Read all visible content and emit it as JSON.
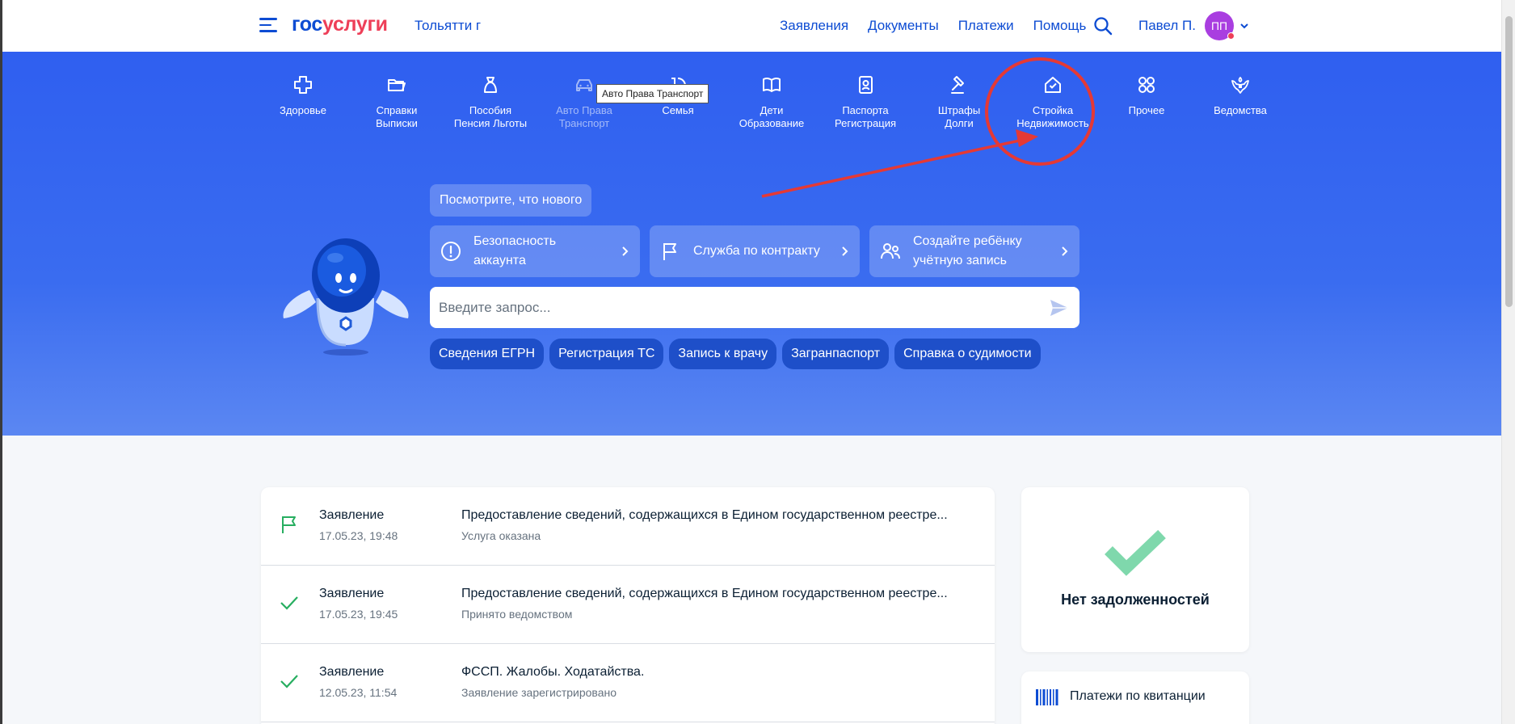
{
  "header": {
    "logo_part1": "гос",
    "logo_part2": "услуги",
    "city": "Тольятти г",
    "nav": [
      "Заявления",
      "Документы",
      "Платежи",
      "Помощь"
    ],
    "user_name": "Павел П.",
    "avatar_initials": "ПП",
    "brand_color": "#0d4cd3",
    "accent_color": "#ee3f58"
  },
  "categories": [
    {
      "line1": "Здоровье",
      "line2": "",
      "icon": "medical-cross-icon"
    },
    {
      "line1": "Справки",
      "line2": "Выписки",
      "icon": "folder-icon"
    },
    {
      "line1": "Пособия",
      "line2": "Пенсия Льготы",
      "icon": "money-bag-icon"
    },
    {
      "line1": "Авто Права",
      "line2": "Транспорт",
      "icon": "car-icon"
    },
    {
      "line1": "Семья",
      "line2": "",
      "icon": "stroller-icon"
    },
    {
      "line1": "Дети",
      "line2": "Образование",
      "icon": "book-icon"
    },
    {
      "line1": "Паспорта",
      "line2": "Регистрация",
      "icon": "passport-icon"
    },
    {
      "line1": "Штрафы",
      "line2": "Долги",
      "icon": "gavel-icon"
    },
    {
      "line1": "Стройка",
      "line2": "Недвижимость",
      "icon": "house-icon"
    },
    {
      "line1": "Прочее",
      "line2": "",
      "icon": "grid-icon"
    },
    {
      "line1": "Ведомства",
      "line2": "",
      "icon": "coat-of-arms-icon"
    }
  ],
  "tooltip": "Авто Права Транспорт",
  "hero": {
    "news_chip": "Посмотрите, что нового",
    "cards": [
      {
        "line1": "Безопасность",
        "line2": "аккаунта",
        "icon": "alert-circle-icon"
      },
      {
        "line1": "Служба по контракту",
        "line2": "",
        "icon": "flag-icon"
      },
      {
        "line1": "Создайте ребёнку",
        "line2": "учётную запись",
        "icon": "users-icon"
      }
    ],
    "search_placeholder": "Введите запрос...",
    "quick_chips": [
      "Сведения ЕГРН",
      "Регистрация ТС",
      "Запись к врачу",
      "Загранпаспорт",
      "Справка о судимости"
    ]
  },
  "feed": [
    {
      "type": "Заявление",
      "date": "17.05.23, 19:48",
      "title": "Предоставление сведений, содержащихся в Едином государственном реестре...",
      "status": "Услуга оказана",
      "icon": "flag-icon"
    },
    {
      "type": "Заявление",
      "date": "17.05.23, 19:45",
      "title": "Предоставление сведений, содержащихся в Едином государственном реестре...",
      "status": "Принято ведомством",
      "icon": "check-icon"
    },
    {
      "type": "Заявление",
      "date": "12.05.23, 11:54",
      "title": "ФССП. Жалобы. Ходатайства.",
      "status": "Заявление зарегистрировано",
      "icon": "check-icon"
    }
  ],
  "debt_card": {
    "title": "Нет задолженностей",
    "check_color": "#7fd8ac"
  },
  "payments_card": {
    "title": "Платежи по квитанции",
    "icon": "barcode-icon"
  },
  "annotation": {
    "color": "#e53935"
  }
}
